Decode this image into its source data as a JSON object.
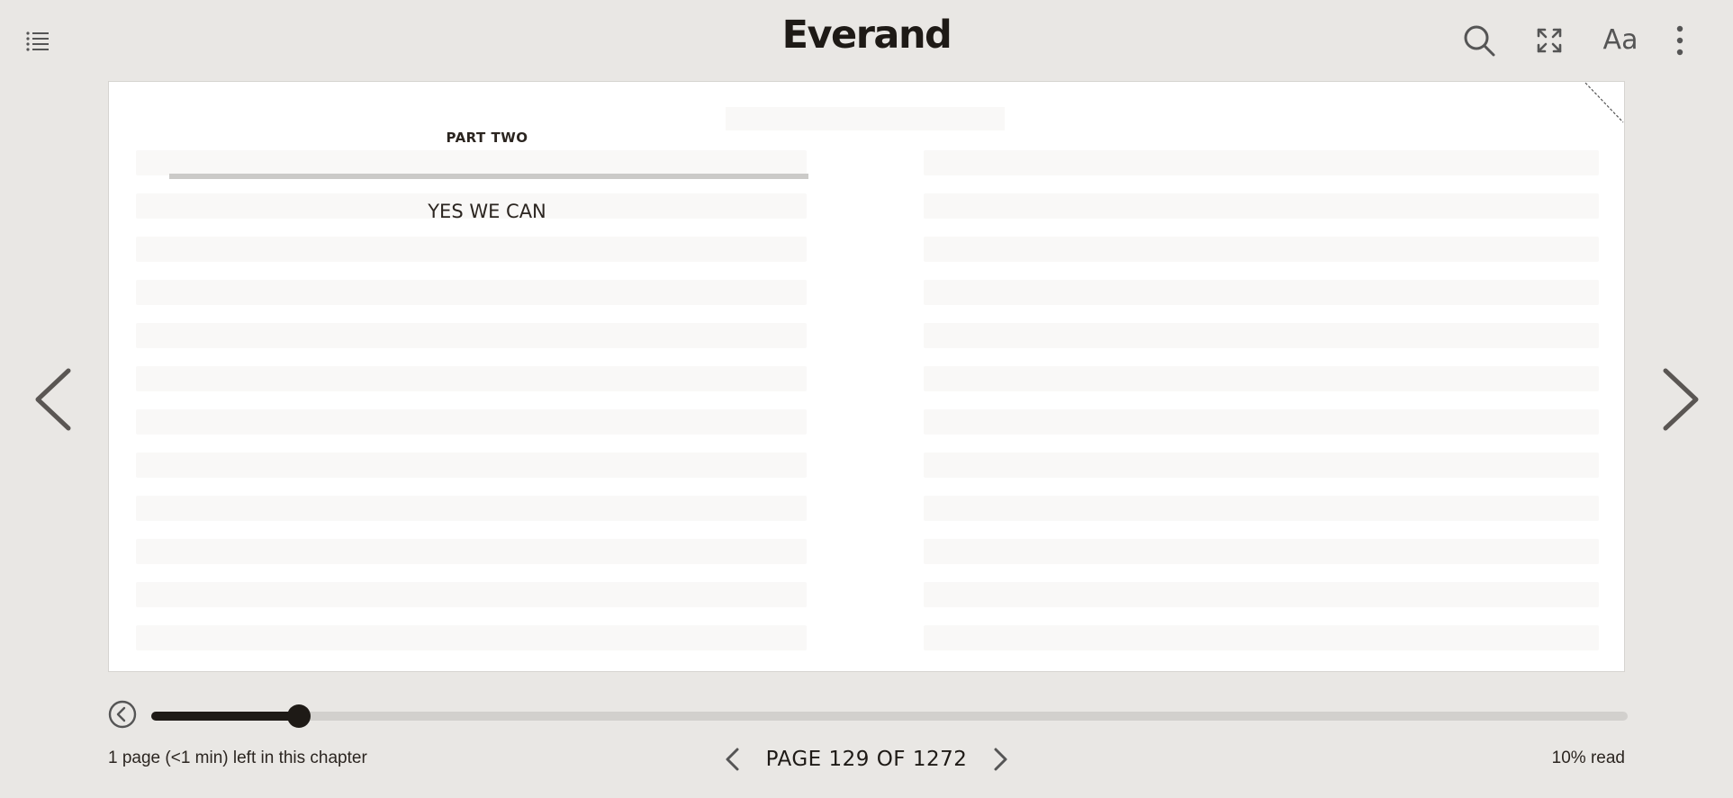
{
  "header": {
    "logo": "Everand",
    "font_button_label": "Aa"
  },
  "page": {
    "part_label": "PART TWO",
    "chapter_title": "YES WE CAN"
  },
  "progress": {
    "fraction": 0.1
  },
  "footer": {
    "chapter_remaining": "1 page (<1 min) left in this chapter",
    "page_indicator": "PAGE 129 OF 1272",
    "percent_read": "10% read"
  },
  "icons": {
    "toc": "list-icon",
    "search": "search-icon",
    "fullscreen": "expand-icon",
    "font": "font-settings-icon",
    "more": "more-vertical-icon",
    "prev": "chevron-left-icon",
    "next": "chevron-right-icon",
    "back": "back-circle-icon"
  },
  "colors": {
    "background": "#e9e7e4",
    "ink": "#1e1a16",
    "page": "#ffffff"
  }
}
